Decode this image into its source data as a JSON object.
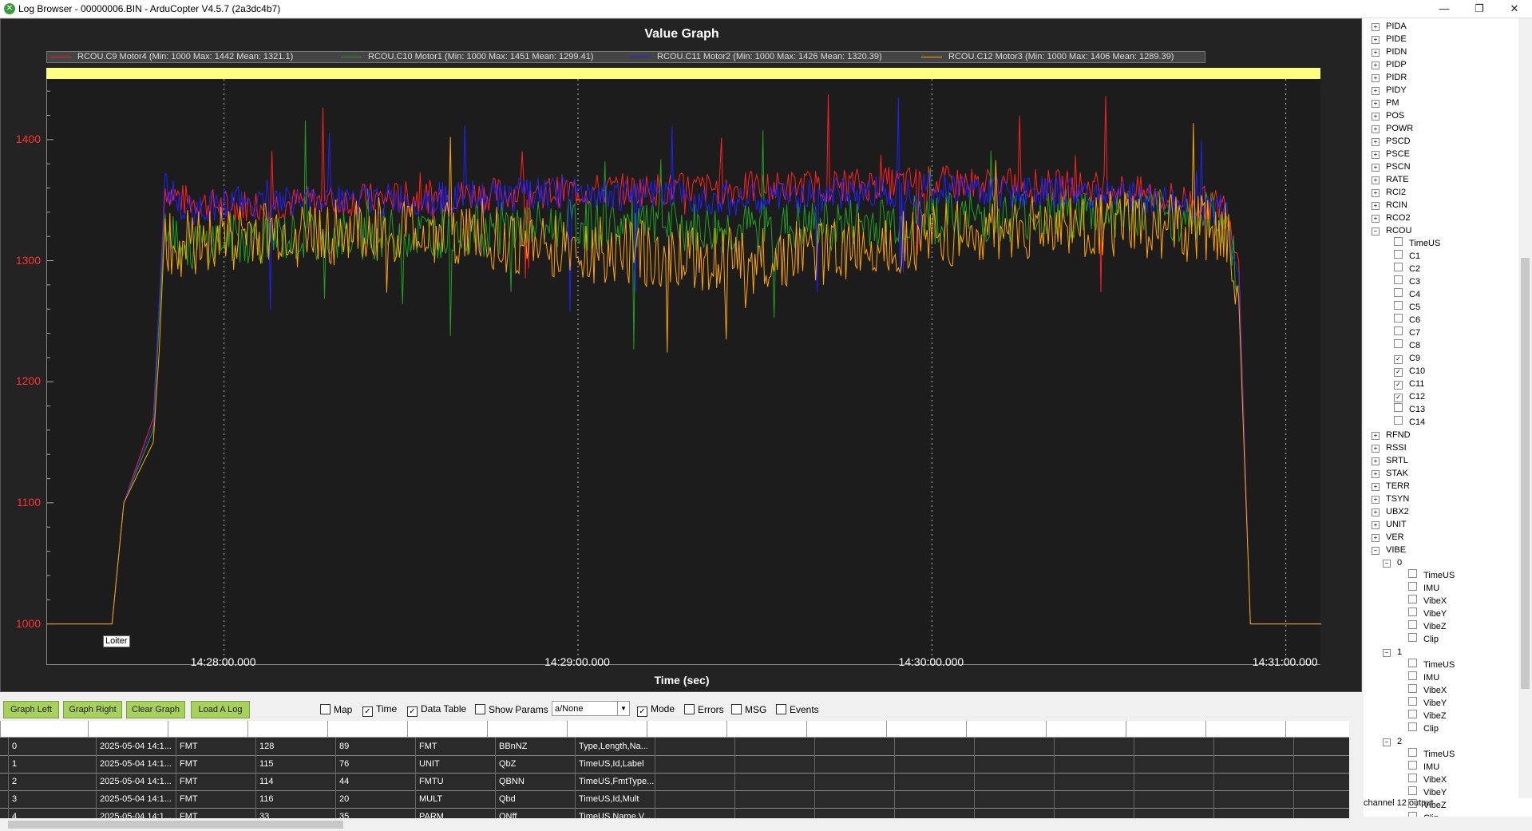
{
  "window": {
    "title": "Log Browser - 00000006.BIN - ArduCopter V4.5.7 (2a3dc4b7)"
  },
  "graph": {
    "title": "Value Graph",
    "xlabel": "Time (sec)",
    "mode_label": "Loiter",
    "legend": [
      {
        "label": "RCOU.C9 Motor4 (Min: 1000 Max: 1442 Mean: 1321.1)",
        "color": "#ff2020"
      },
      {
        "label": "RCOU.C10 Motor1 (Min: 1000 Max: 1451 Mean: 1299.41)",
        "color": "#20a020"
      },
      {
        "label": "RCOU.C11 Motor2 (Min: 1000 Max: 1426 Mean: 1320.39)",
        "color": "#2020ff"
      },
      {
        "label": "RCOU.C12 Motor3 (Min: 1000 Max: 1406 Mean: 1289.39)",
        "color": "#ffa500"
      }
    ],
    "yticks": [
      "1400",
      "1300",
      "1200",
      "1100",
      "1000"
    ],
    "xticks": [
      "14:28:00.000",
      "14:29:00.000",
      "14:30:00.000",
      "14:31:00.000"
    ]
  },
  "chart_data": {
    "type": "line",
    "xlabel": "Time (sec)",
    "ylabel": "",
    "ylim": [
      1000,
      1450
    ],
    "x_start": "14:27:30",
    "x_end": "14:31:06",
    "x": [
      "14:27:30",
      "14:27:41",
      "14:27:43",
      "14:27:48",
      "14:27:50",
      "14:27:53",
      "14:28:00",
      "14:28:30",
      "14:29:00",
      "14:29:30",
      "14:30:00",
      "14:30:30",
      "14:30:50",
      "14:30:52",
      "14:30:54",
      "14:31:06"
    ],
    "series": [
      {
        "name": "RCOU.C9 Motor4",
        "color": "#ff2020",
        "values": [
          1000,
          1000,
          1100,
          1170,
          1360,
          1350,
          1345,
          1352,
          1358,
          1360,
          1365,
          1360,
          1345,
          1300,
          1000,
          1000
        ]
      },
      {
        "name": "RCOU.C10 Motor1",
        "color": "#20a020",
        "values": [
          1000,
          1000,
          1100,
          1160,
          1340,
          1310,
          1318,
          1322,
          1330,
          1325,
          1335,
          1340,
          1335,
          1280,
          1000,
          1000
        ]
      },
      {
        "name": "RCOU.C11 Motor2",
        "color": "#2020ff",
        "values": [
          1000,
          1000,
          1100,
          1165,
          1365,
          1340,
          1348,
          1350,
          1356,
          1350,
          1360,
          1355,
          1340,
          1290,
          1000,
          1000
        ]
      },
      {
        "name": "RCOU.C12 Motor3",
        "color": "#ffa500",
        "values": [
          1000,
          1000,
          1100,
          1150,
          1300,
          1315,
          1320,
          1325,
          1310,
          1300,
          1320,
          1330,
          1325,
          1270,
          1000,
          1000
        ]
      }
    ]
  },
  "toolbar": {
    "graph_left": "Graph Left",
    "graph_right": "Graph Right",
    "clear_graph": "Clear Graph",
    "load_log": "Load A Log",
    "map": "Map",
    "time": "Time",
    "data_table": "Data Table",
    "show_params": "Show Params",
    "combo_value": "a/None",
    "mode": "Mode",
    "errors": "Errors",
    "msg": "MSG",
    "events": "Events"
  },
  "table": {
    "rows": [
      [
        "0",
        "2025-05-04 14:1...",
        "FMT",
        "128",
        "89",
        "FMT",
        "BBnNZ",
        "Type,Length,Na..."
      ],
      [
        "1",
        "2025-05-04 14:1...",
        "FMT",
        "115",
        "76",
        "UNIT",
        "QbZ",
        "TimeUS,Id,Label"
      ],
      [
        "2",
        "2025-05-04 14:1...",
        "FMT",
        "114",
        "44",
        "FMTU",
        "QBNN",
        "TimeUS,FmtType..."
      ],
      [
        "3",
        "2025-05-04 14:1...",
        "FMT",
        "116",
        "20",
        "MULT",
        "Qbd",
        "TimeUS,Id,Mult"
      ],
      [
        "4",
        "2025-05-04 14:1...",
        "FMT",
        "33",
        "35",
        "PARM",
        "QNff",
        "TimeUS,Name,V..."
      ]
    ]
  },
  "tree": {
    "top_items": [
      "PIDA",
      "PIDE",
      "PIDN",
      "PIDP",
      "PIDR",
      "PIDY",
      "PM",
      "POS",
      "POWR",
      "PSCD",
      "PSCE",
      "PSCN",
      "RATE",
      "RCI2",
      "RCIN",
      "RCO2",
      "RCOU"
    ],
    "rcou_children": [
      "TimeUS",
      "C1",
      "C2",
      "C3",
      "C4",
      "C5",
      "C6",
      "C7",
      "C8",
      "C9",
      "C10",
      "C11",
      "C12",
      "C13",
      "C14"
    ],
    "checked": [
      "C9",
      "C10",
      "C11",
      "C12"
    ],
    "mid_items": [
      "RFND",
      "RSSI",
      "SRTL",
      "STAK",
      "TERR",
      "TSYN",
      "UBX2",
      "UNIT",
      "VER",
      "VIBE"
    ],
    "vibe_instances": [
      "0",
      "1",
      "2"
    ],
    "vibe_children": [
      "TimeUS",
      "IMU",
      "VibeX",
      "VibeY",
      "VibeZ",
      "Clip"
    ],
    "status": "channel 12 output"
  }
}
